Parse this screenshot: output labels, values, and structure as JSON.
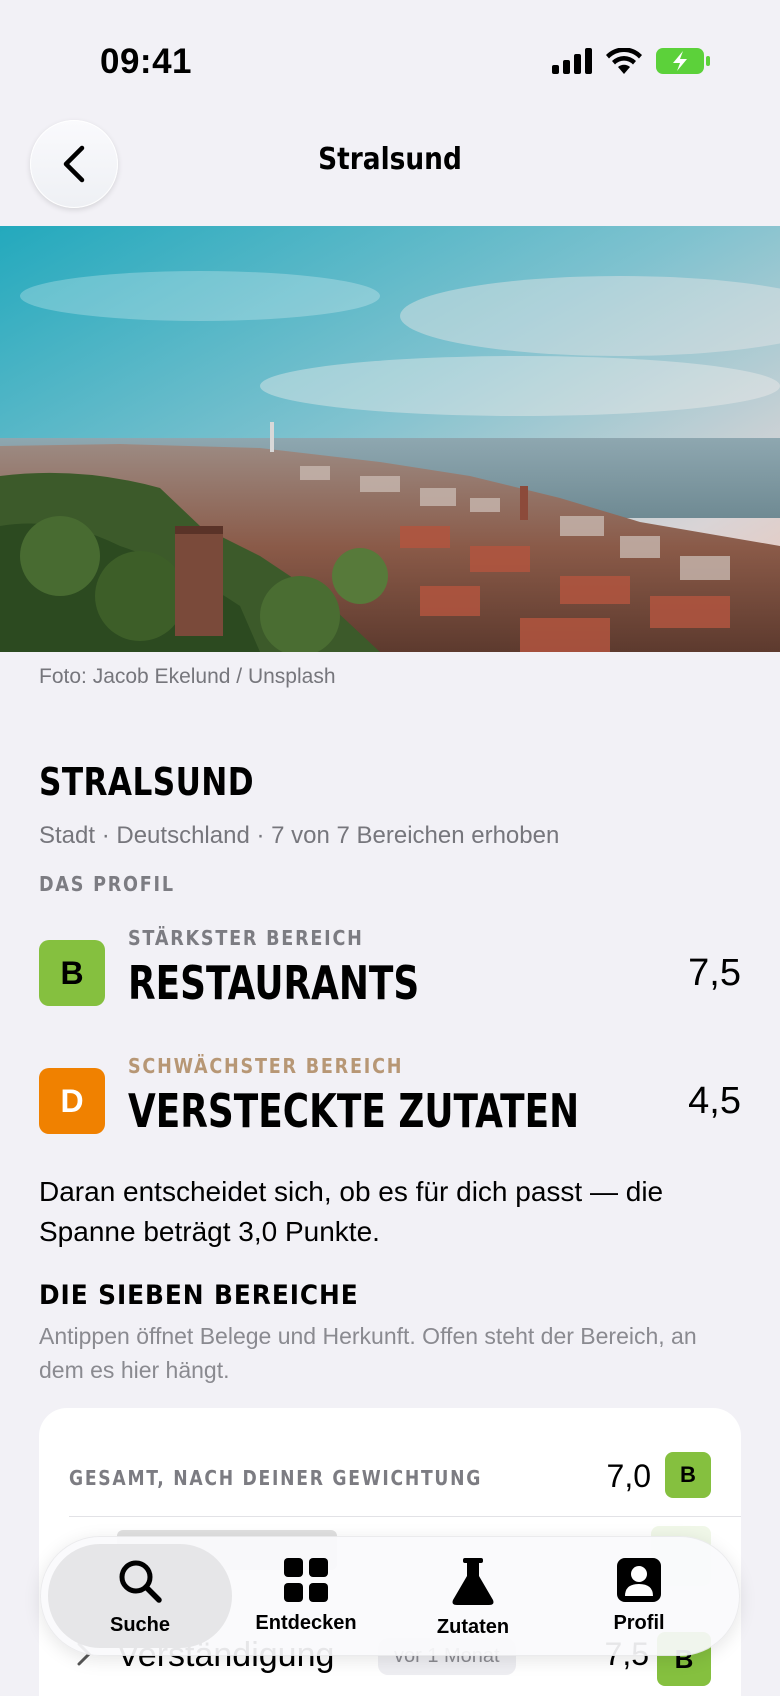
{
  "status_bar": {
    "time": "09:41"
  },
  "nav": {
    "title": "Stralsund"
  },
  "hero": {
    "photo_credit": "Foto: Jacob Ekelund / Unsplash"
  },
  "city": {
    "title": "STRALSUND",
    "subtitle": "Stadt · Deutschland · 7 von 7 Bereichen erhoben"
  },
  "profile": {
    "caption": "DAS PROFIL",
    "strongest": {
      "label": "STÄRKSTER BEREICH",
      "name": "RESTAURANTS",
      "grade": "B",
      "score": "7,5",
      "grade_color": "#85c03f",
      "label_color": "#7c7c82"
    },
    "weakest": {
      "label": "SCHWÄCHSTER BEREICH",
      "name": "VERSTECKTE ZUTATEN",
      "grade": "D",
      "score": "4,5",
      "grade_color": "#f08100",
      "label_color": "#b79775"
    },
    "summary": "Daran entscheidet sich, ob es für dich passt — die Spanne beträgt 3,0 Punkte."
  },
  "areas": {
    "heading": "DIE SIEBEN BEREICHE",
    "description": "Antippen öffnet Belege und Herkunft. Offen steht der Bereich, an dem es hier hängt.",
    "total": {
      "label": "GESAMT, NACH DEINER GEWICHTUNG",
      "score": "7,0",
      "grade": "B"
    },
    "rows": [
      {
        "name": "Verständigung",
        "chip": "vor 1 Monat",
        "score": "7,5",
        "grade": "B"
      }
    ]
  },
  "tab_bar": {
    "tabs": [
      {
        "label": "Suche",
        "icon": "search-icon",
        "active": true
      },
      {
        "label": "Entdecken",
        "icon": "grid-icon",
        "active": false
      },
      {
        "label": "Zutaten",
        "icon": "flask-icon",
        "active": false
      },
      {
        "label": "Profil",
        "icon": "profile-icon",
        "active": false
      }
    ]
  },
  "colors": {
    "accent_green": "#85c03f",
    "accent_orange": "#f08100",
    "background": "#f2f1f6"
  }
}
